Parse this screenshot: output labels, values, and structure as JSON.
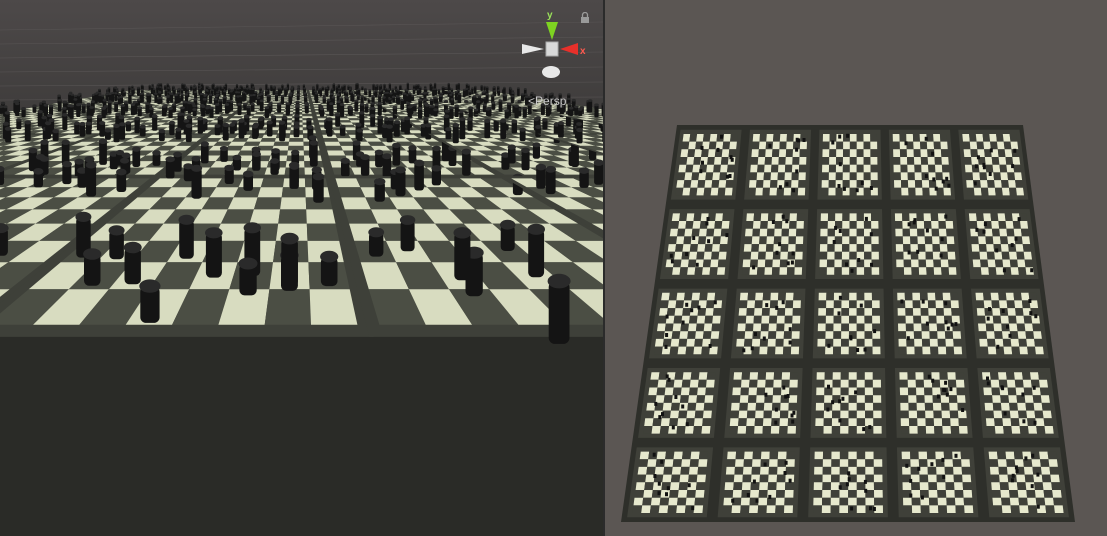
{
  "scene_view": {
    "projection_label": "Persp",
    "gizmo": {
      "axis_y": "y",
      "axis_x": "x"
    },
    "colors": {
      "sky": "#4a4646",
      "axis_y": "#7ed321",
      "axis_x": "#e8302a",
      "axis_neutral": "#cfcfcf",
      "board_light": "#d8dcc0",
      "board_dark": "#4b4e44",
      "piece": "#141414"
    }
  },
  "game_view": {
    "board_grid": {
      "rows": 5,
      "cols": 5
    },
    "colors": {
      "background": "#5b5653",
      "board_light": "#e6e8cd",
      "board_dark": "#3f4039"
    }
  }
}
